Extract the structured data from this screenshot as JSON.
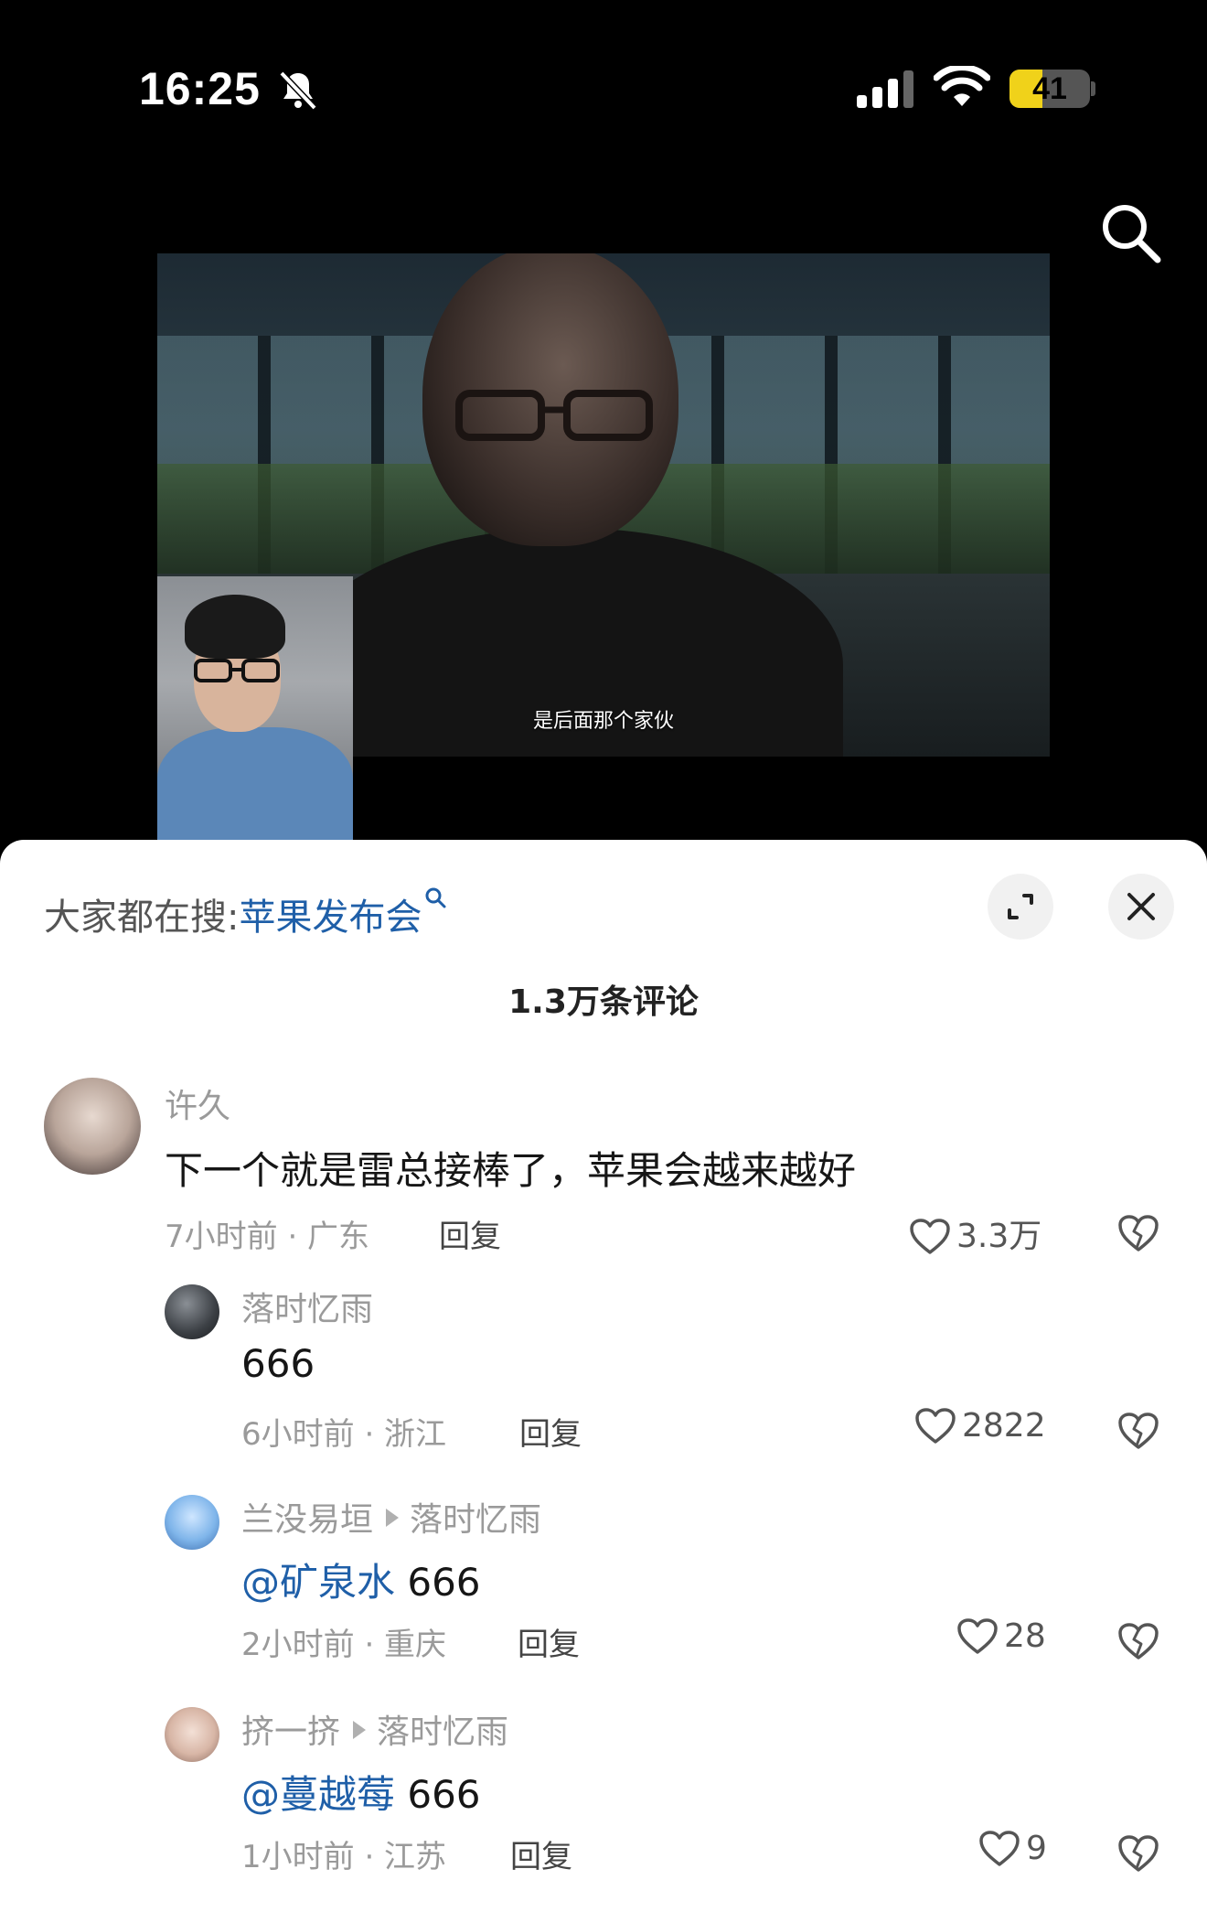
{
  "status_bar": {
    "time": "16:25",
    "battery": "41",
    "battery_level": 0.41
  },
  "video": {
    "subtitle": "是后面那个家伙"
  },
  "sheet": {
    "trending_prefix": "大家都在搜:",
    "trending_term": "苹果发布会",
    "comment_count": "1.3万条评论"
  },
  "comments": [
    {
      "user": "许久",
      "text": "下一个就是雷总接棒了，苹果会越来越好",
      "time_location": "7小时前 · 广东",
      "reply_label": "回复",
      "likes": "3.3万"
    },
    {
      "user": "落时忆雨",
      "text": "666",
      "time_location": "6小时前 · 浙江",
      "reply_label": "回复",
      "likes": "2822"
    },
    {
      "user": "兰没易垣",
      "reply_to": "落时忆雨",
      "mention": "@矿泉水",
      "text": " 666",
      "time_location": "2小时前 · 重庆",
      "reply_label": "回复",
      "likes": "28"
    },
    {
      "user": "挤一挤",
      "reply_to": "落时忆雨",
      "mention": "@蔓越莓",
      "text": " 666",
      "time_location": "1小时前 · 江苏",
      "reply_label": "回复",
      "likes": "9"
    }
  ],
  "icons": {
    "status": [
      "bell-off-icon",
      "signal-icon",
      "wifi-icon",
      "battery-icon"
    ],
    "actions": [
      "search-icon",
      "expand-icon",
      "close-icon",
      "heart-icon",
      "broken-heart-icon"
    ]
  }
}
